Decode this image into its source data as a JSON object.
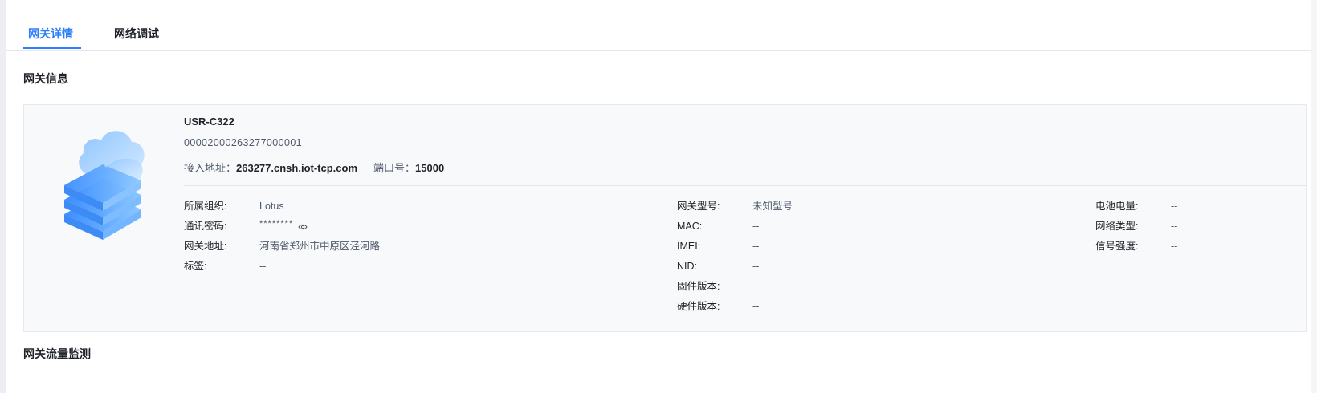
{
  "tabs": [
    {
      "label": "网关详情",
      "active": true
    },
    {
      "label": "网络调试",
      "active": false
    }
  ],
  "sections": {
    "gateway_info_title": "网关信息",
    "traffic_monitor_title": "网关流量监测"
  },
  "gateway": {
    "name": "USR-C322",
    "id": "00002000263277000001",
    "access_address_label": "接入地址：",
    "access_address": "263277.cnsh.iot-tcp.com",
    "port_label": "端口号：",
    "port": "15000",
    "icon": "server-cloud-icon"
  },
  "details": {
    "col1": [
      {
        "label": "所属组织:",
        "value": "Lotus"
      },
      {
        "label": "通讯密码:",
        "value": "********",
        "masked": true,
        "icon": "eye-icon"
      },
      {
        "label": "网关地址:",
        "value": "河南省郑州市中原区泾河路"
      },
      {
        "label": "标签:",
        "value": "--"
      }
    ],
    "col2": [
      {
        "label": "网关型号:",
        "value": "未知型号"
      },
      {
        "label": "MAC:",
        "value": "--"
      },
      {
        "label": "IMEI:",
        "value": "--"
      },
      {
        "label": "NID:",
        "value": "--"
      },
      {
        "label": "固件版本:",
        "value": ""
      },
      {
        "label": "硬件版本:",
        "value": "--"
      }
    ],
    "col3": [
      {
        "label": "电池电量:",
        "value": "--"
      },
      {
        "label": "网络类型:",
        "value": "--"
      },
      {
        "label": "信号强度:",
        "value": "--"
      }
    ]
  },
  "colors": {
    "accent": "#2d7ff9",
    "card_bg": "#f8f9fb",
    "text_primary": "#1f2329",
    "text_secondary": "#4e5969"
  }
}
